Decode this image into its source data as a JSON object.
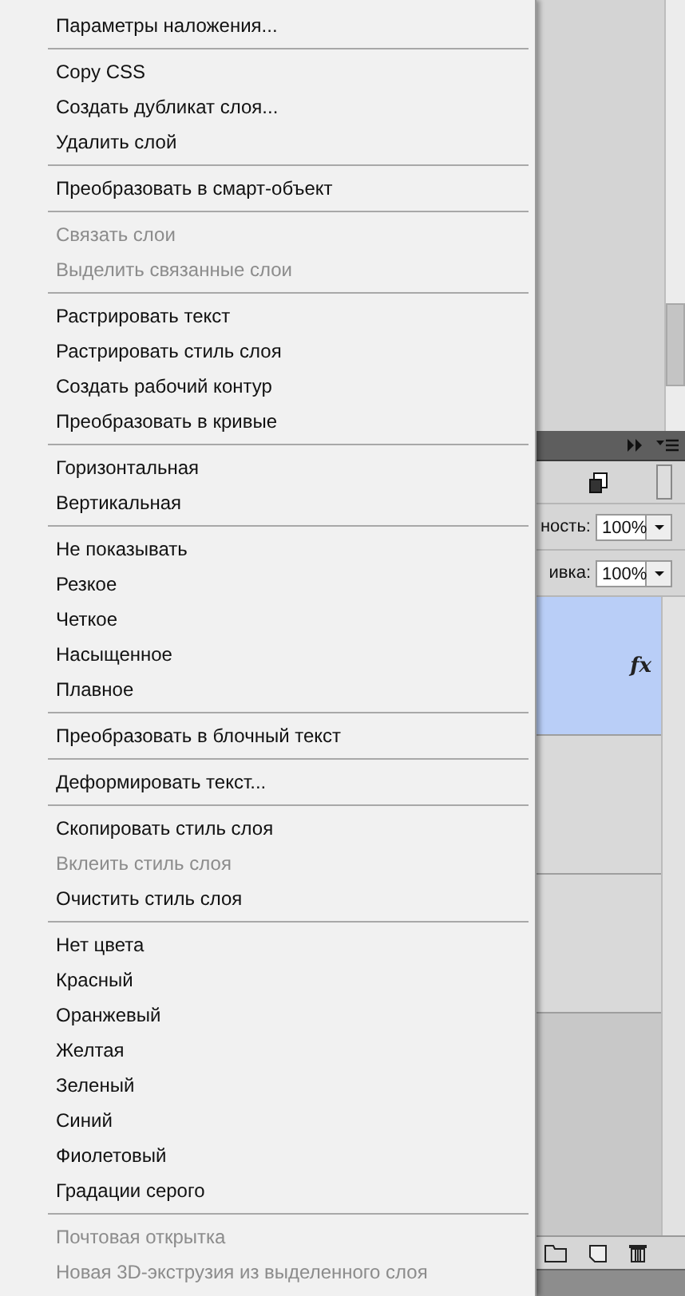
{
  "context_menu": {
    "groups": [
      {
        "items": [
          {
            "label": "Параметры наложения...",
            "disabled": false
          }
        ]
      },
      {
        "items": [
          {
            "label": "Copy CSS",
            "disabled": false
          },
          {
            "label": "Создать дубликат слоя...",
            "disabled": false
          },
          {
            "label": "Удалить слой",
            "disabled": false
          }
        ]
      },
      {
        "items": [
          {
            "label": "Преобразовать в смарт-объект",
            "disabled": false
          }
        ]
      },
      {
        "items": [
          {
            "label": "Связать слои",
            "disabled": true
          },
          {
            "label": "Выделить связанные слои",
            "disabled": true
          }
        ]
      },
      {
        "items": [
          {
            "label": "Растрировать текст",
            "disabled": false
          },
          {
            "label": "Растрировать стиль слоя",
            "disabled": false
          },
          {
            "label": "Создать рабочий контур",
            "disabled": false
          },
          {
            "label": "Преобразовать в кривые",
            "disabled": false
          }
        ]
      },
      {
        "items": [
          {
            "label": "Горизонтальная",
            "disabled": false
          },
          {
            "label": "Вертикальная",
            "disabled": false
          }
        ]
      },
      {
        "items": [
          {
            "label": "Не показывать",
            "disabled": false
          },
          {
            "label": "Резкое",
            "disabled": false
          },
          {
            "label": "Четкое",
            "disabled": false
          },
          {
            "label": "Насыщенное",
            "disabled": false
          },
          {
            "label": "Плавное",
            "disabled": false
          }
        ]
      },
      {
        "items": [
          {
            "label": "Преобразовать в блочный текст",
            "disabled": false
          }
        ]
      },
      {
        "items": [
          {
            "label": "Деформировать текст...",
            "disabled": false
          }
        ]
      },
      {
        "items": [
          {
            "label": "Скопировать стиль слоя",
            "disabled": false
          },
          {
            "label": "Вклеить стиль слоя",
            "disabled": true
          },
          {
            "label": "Очистить стиль слоя",
            "disabled": false
          }
        ]
      },
      {
        "items": [
          {
            "label": "Нет цвета",
            "disabled": false
          },
          {
            "label": "Красный",
            "disabled": false
          },
          {
            "label": "Оранжевый",
            "disabled": false
          },
          {
            "label": "Желтая",
            "disabled": false
          },
          {
            "label": "Зеленый",
            "disabled": false
          },
          {
            "label": "Синий",
            "disabled": false
          },
          {
            "label": "Фиолетовый",
            "disabled": false
          },
          {
            "label": "Градации серого",
            "disabled": false
          }
        ]
      },
      {
        "items": [
          {
            "label": "Почтовая открытка",
            "disabled": true
          },
          {
            "label": "Новая 3D-экструзия из выделенного слоя",
            "disabled": true
          }
        ]
      }
    ]
  },
  "layers_panel": {
    "opacity_label": "ность:",
    "opacity_value": "100%",
    "fill_label": "ивка:",
    "fill_value": "100%",
    "layers": [
      {
        "selected": true,
        "effects_mark": "fx"
      },
      {
        "selected": false
      },
      {
        "selected": false
      }
    ]
  }
}
